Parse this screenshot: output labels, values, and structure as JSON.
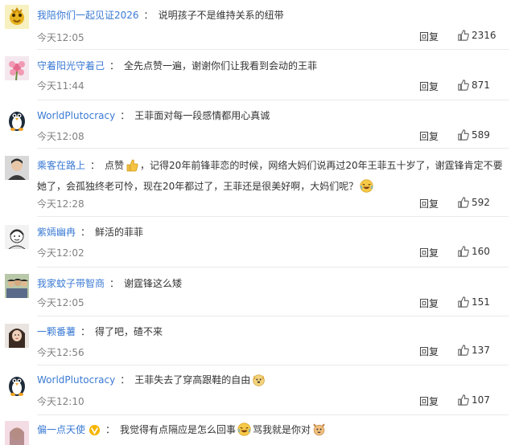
{
  "colors": {
    "username": "#3a7ad4",
    "text": "#333333",
    "time": "#808080",
    "divider": "#eaeaea"
  },
  "reply_label": "回复",
  "comments": [
    {
      "user": "我陪你们一起见证2026",
      "text": "说明孩子不是维持关系的纽带",
      "time": "今天12:05",
      "likes": "2316",
      "avatar": "golden-bird-avatar"
    },
    {
      "user": "守着阳光守着己",
      "text": "全先点赞一遍，谢谢你们让我看到会动的王菲",
      "time": "今天11:44",
      "likes": "871",
      "avatar": "pink-flower-avatar"
    },
    {
      "user": "WorldPlutocracy",
      "text": "王菲面对每一段感情都用心真诚",
      "time": "今天12:08",
      "likes": "589",
      "avatar": "penguin-avatar"
    },
    {
      "user": "乘客在路上",
      "text_a": "点赞",
      "text_b": "，记得20年前锋菲恋的时候，网络大妈们说再过20年王菲五十岁了，谢霆锋肯定不要她了，会孤独终老可怜，现在20年都过了，王菲还是很美好啊，大妈们呢？",
      "time": "今天12:28",
      "likes": "592",
      "avatar": "man-portrait-avatar"
    },
    {
      "user": "紫嫣幽冉",
      "text": "鲜活的菲菲",
      "time": "今天12:02",
      "likes": "160",
      "avatar": "sketch-face-avatar"
    },
    {
      "user": "我家蚊子带智商",
      "text": "谢霆锋这么矮",
      "time": "今天12:05",
      "likes": "151",
      "avatar": "group-photo-avatar"
    },
    {
      "user": "一颗番薯",
      "text": "得了吧，碴不来",
      "time": "今天12:56",
      "likes": "137",
      "avatar": "girl-portrait-avatar"
    },
    {
      "user": "WorldPlutocracy",
      "text": "王菲失去了穿高跟鞋的自由",
      "time": "今天12:10",
      "likes": "107",
      "avatar": "penguin-avatar"
    },
    {
      "user": "偏一点天使",
      "text_a": "我觉得有点隔应是怎么回事",
      "text_b": "骂我就是你对",
      "avatar": "pink-photo-avatar"
    }
  ]
}
